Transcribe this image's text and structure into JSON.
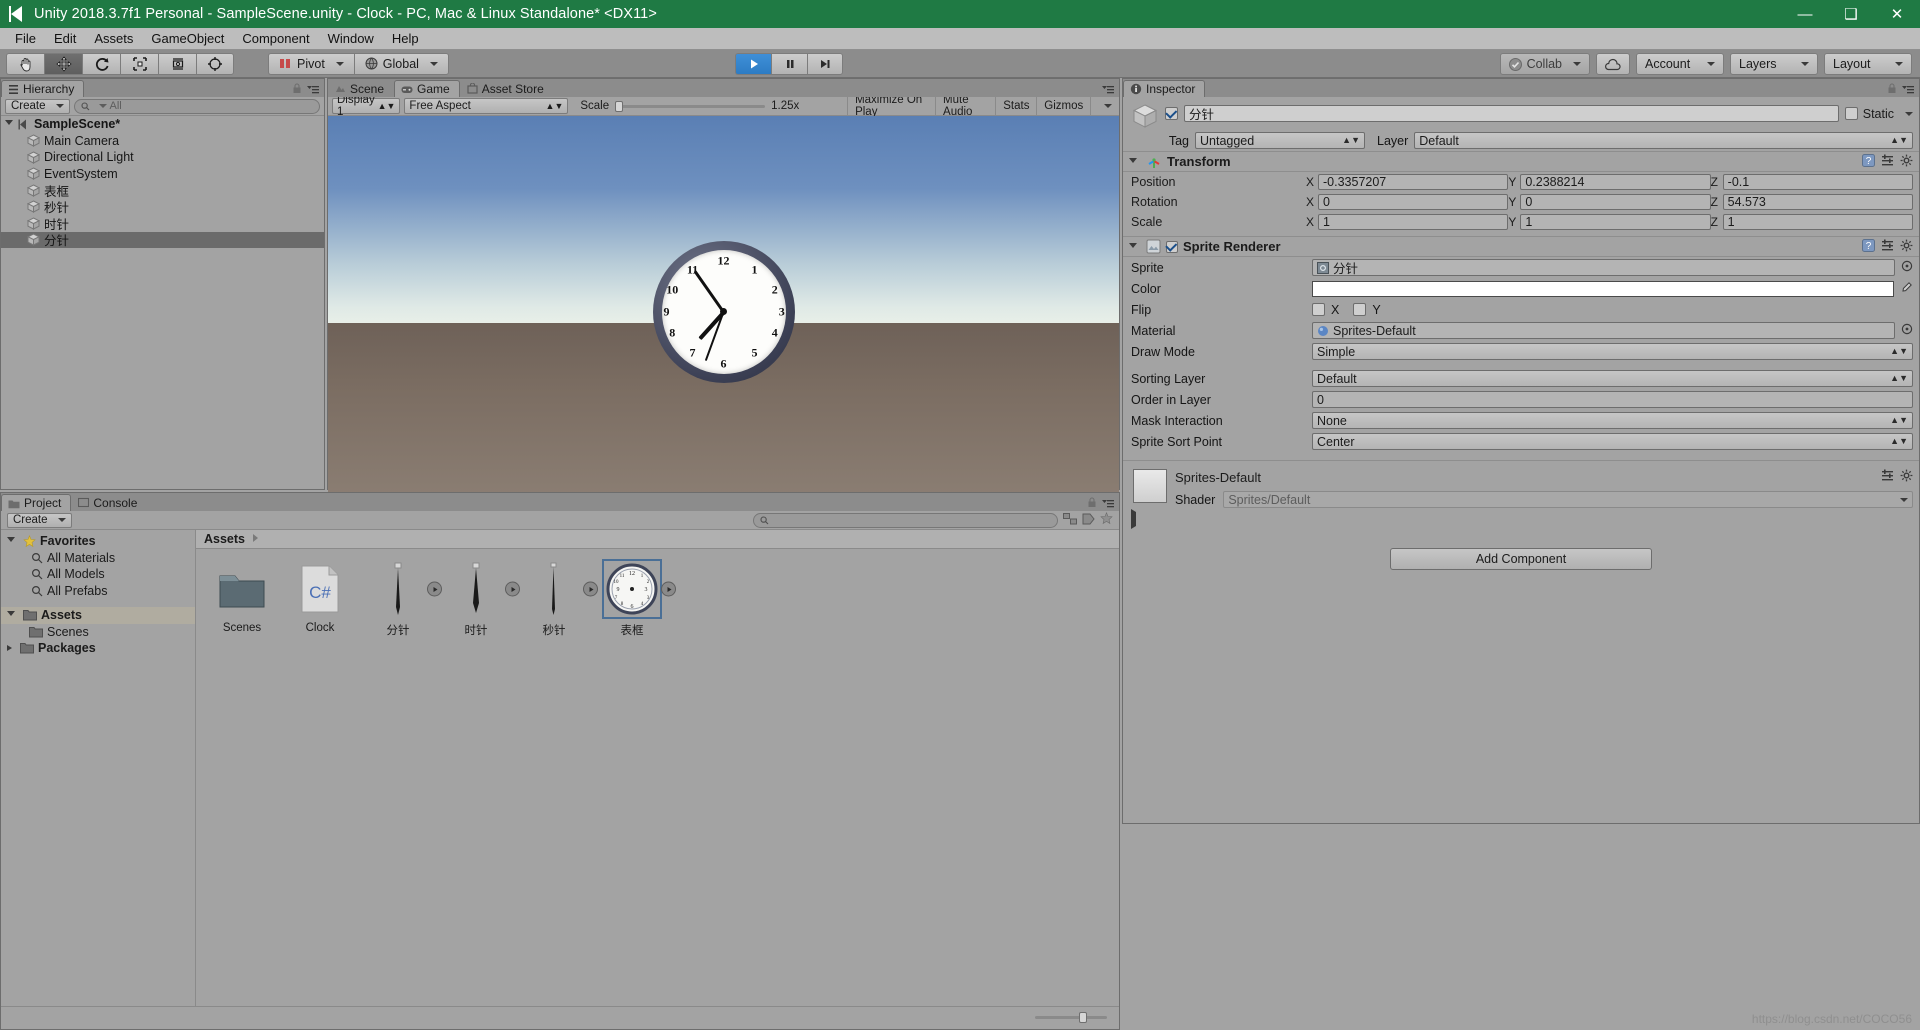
{
  "titlebar": {
    "text": "Unity 2018.3.7f1 Personal - SampleScene.unity - Clock - PC, Mac & Linux Standalone* <DX11>",
    "minimize": "—",
    "maximize": "❑",
    "close": "✕"
  },
  "menubar": {
    "items": [
      "File",
      "Edit",
      "Assets",
      "GameObject",
      "Component",
      "Window",
      "Help"
    ]
  },
  "toolbar": {
    "tools": [
      "hand-tool",
      "move-tool",
      "rotate-tool",
      "scale-tool",
      "rect-tool",
      "transform-tool"
    ],
    "active_tool_index": 1,
    "pivot_label": "Pivot",
    "global_label": "Global",
    "play_label": "play",
    "pause_label": "pause",
    "step_label": "step",
    "collab_label": "Collab",
    "cloud_label": "cloud-services",
    "account_label": "Account",
    "layers_label": "Layers",
    "layout_label": "Layout"
  },
  "hierarchy": {
    "tab": "Hierarchy",
    "create_label": "Create",
    "search_placeholder": "All",
    "scene": "SampleScene*",
    "items": [
      {
        "label": "Main Camera",
        "selected": false
      },
      {
        "label": "Directional Light",
        "selected": false
      },
      {
        "label": "EventSystem",
        "selected": false
      },
      {
        "label": "表框",
        "selected": false
      },
      {
        "label": "秒针",
        "selected": false
      },
      {
        "label": "时针",
        "selected": false
      },
      {
        "label": "分针",
        "selected": true
      }
    ]
  },
  "gameview": {
    "tabs": [
      {
        "label": "Scene",
        "active": false
      },
      {
        "label": "Game",
        "active": true
      },
      {
        "label": "Asset Store",
        "active": false
      }
    ],
    "display": "Display 1",
    "aspect": "Free Aspect",
    "scale_label": "Scale",
    "scale_value": "1.25x",
    "maximize_on_play": "Maximize On Play",
    "mute_audio": "Mute Audio",
    "stats": "Stats",
    "gizmos": "Gizmos",
    "clock": {
      "numbers": [
        "1",
        "2",
        "3",
        "4",
        "5",
        "6",
        "7",
        "8",
        "9",
        "10",
        "11",
        "12"
      ],
      "hour_angle_deg": 222,
      "minute_angle_deg": 325,
      "second_angle_deg": 200
    }
  },
  "inspector": {
    "tab": "Inspector",
    "object_name": "分针",
    "enabled": true,
    "static_label": "Static",
    "tag_label": "Tag",
    "tag_value": "Untagged",
    "layer_label": "Layer",
    "layer_value": "Default",
    "transform": {
      "title": "Transform",
      "rows": [
        {
          "label": "Position",
          "x": "-0.3357207",
          "y": "0.2388214",
          "z": "-0.1"
        },
        {
          "label": "Rotation",
          "x": "0",
          "y": "0",
          "z": "54.573"
        },
        {
          "label": "Scale",
          "x": "1",
          "y": "1",
          "z": "1"
        }
      ],
      "axes": [
        "X",
        "Y",
        "Z"
      ]
    },
    "sprite_renderer": {
      "title": "Sprite Renderer",
      "enabled": true,
      "fields": [
        {
          "label": "Sprite",
          "value": "分针",
          "type": "object"
        },
        {
          "label": "Color",
          "value": "#FFFFFF",
          "type": "color"
        },
        {
          "label": "Flip",
          "value": "",
          "type": "flip"
        },
        {
          "label": "Material",
          "value": "Sprites-Default",
          "type": "object"
        },
        {
          "label": "Draw Mode",
          "value": "Simple",
          "type": "dropdown"
        },
        {
          "label": "Sorting Layer",
          "value": "Default",
          "type": "dropdown"
        },
        {
          "label": "Order in Layer",
          "value": "0",
          "type": "number"
        },
        {
          "label": "Mask Interaction",
          "value": "None",
          "type": "dropdown"
        },
        {
          "label": "Sprite Sort Point",
          "value": "Center",
          "type": "dropdown"
        }
      ],
      "flip_x_label": "X",
      "flip_y_label": "Y"
    },
    "material": {
      "name": "Sprites-Default",
      "shader_label": "Shader",
      "shader_value": "Sprites/Default"
    },
    "add_component": "Add Component"
  },
  "project": {
    "tabs": [
      {
        "label": "Project",
        "active": true
      },
      {
        "label": "Console",
        "active": false
      }
    ],
    "create_label": "Create",
    "search_placeholder": "",
    "favorites": {
      "label": "Favorites",
      "items": [
        "All Materials",
        "All Models",
        "All Prefabs"
      ]
    },
    "tree": [
      {
        "label": "Assets",
        "selected": true,
        "bold": true
      },
      {
        "label": "Scenes",
        "selected": false,
        "bold": false
      },
      {
        "label": "Packages",
        "selected": false,
        "bold": true
      }
    ],
    "breadcrumb": "Assets",
    "assets": [
      {
        "label": "Scenes",
        "type": "folder",
        "selected": false
      },
      {
        "label": "Clock",
        "type": "csharp",
        "selected": false
      },
      {
        "label": "分针",
        "type": "sprite-hand",
        "selected": false
      },
      {
        "label": "时针",
        "type": "sprite-hand",
        "selected": false
      },
      {
        "label": "秒针",
        "type": "sprite-hand",
        "selected": false
      },
      {
        "label": "表框",
        "type": "sprite-clock",
        "selected": true
      }
    ]
  },
  "watermark": "https://blog.csdn.net/COCO56"
}
